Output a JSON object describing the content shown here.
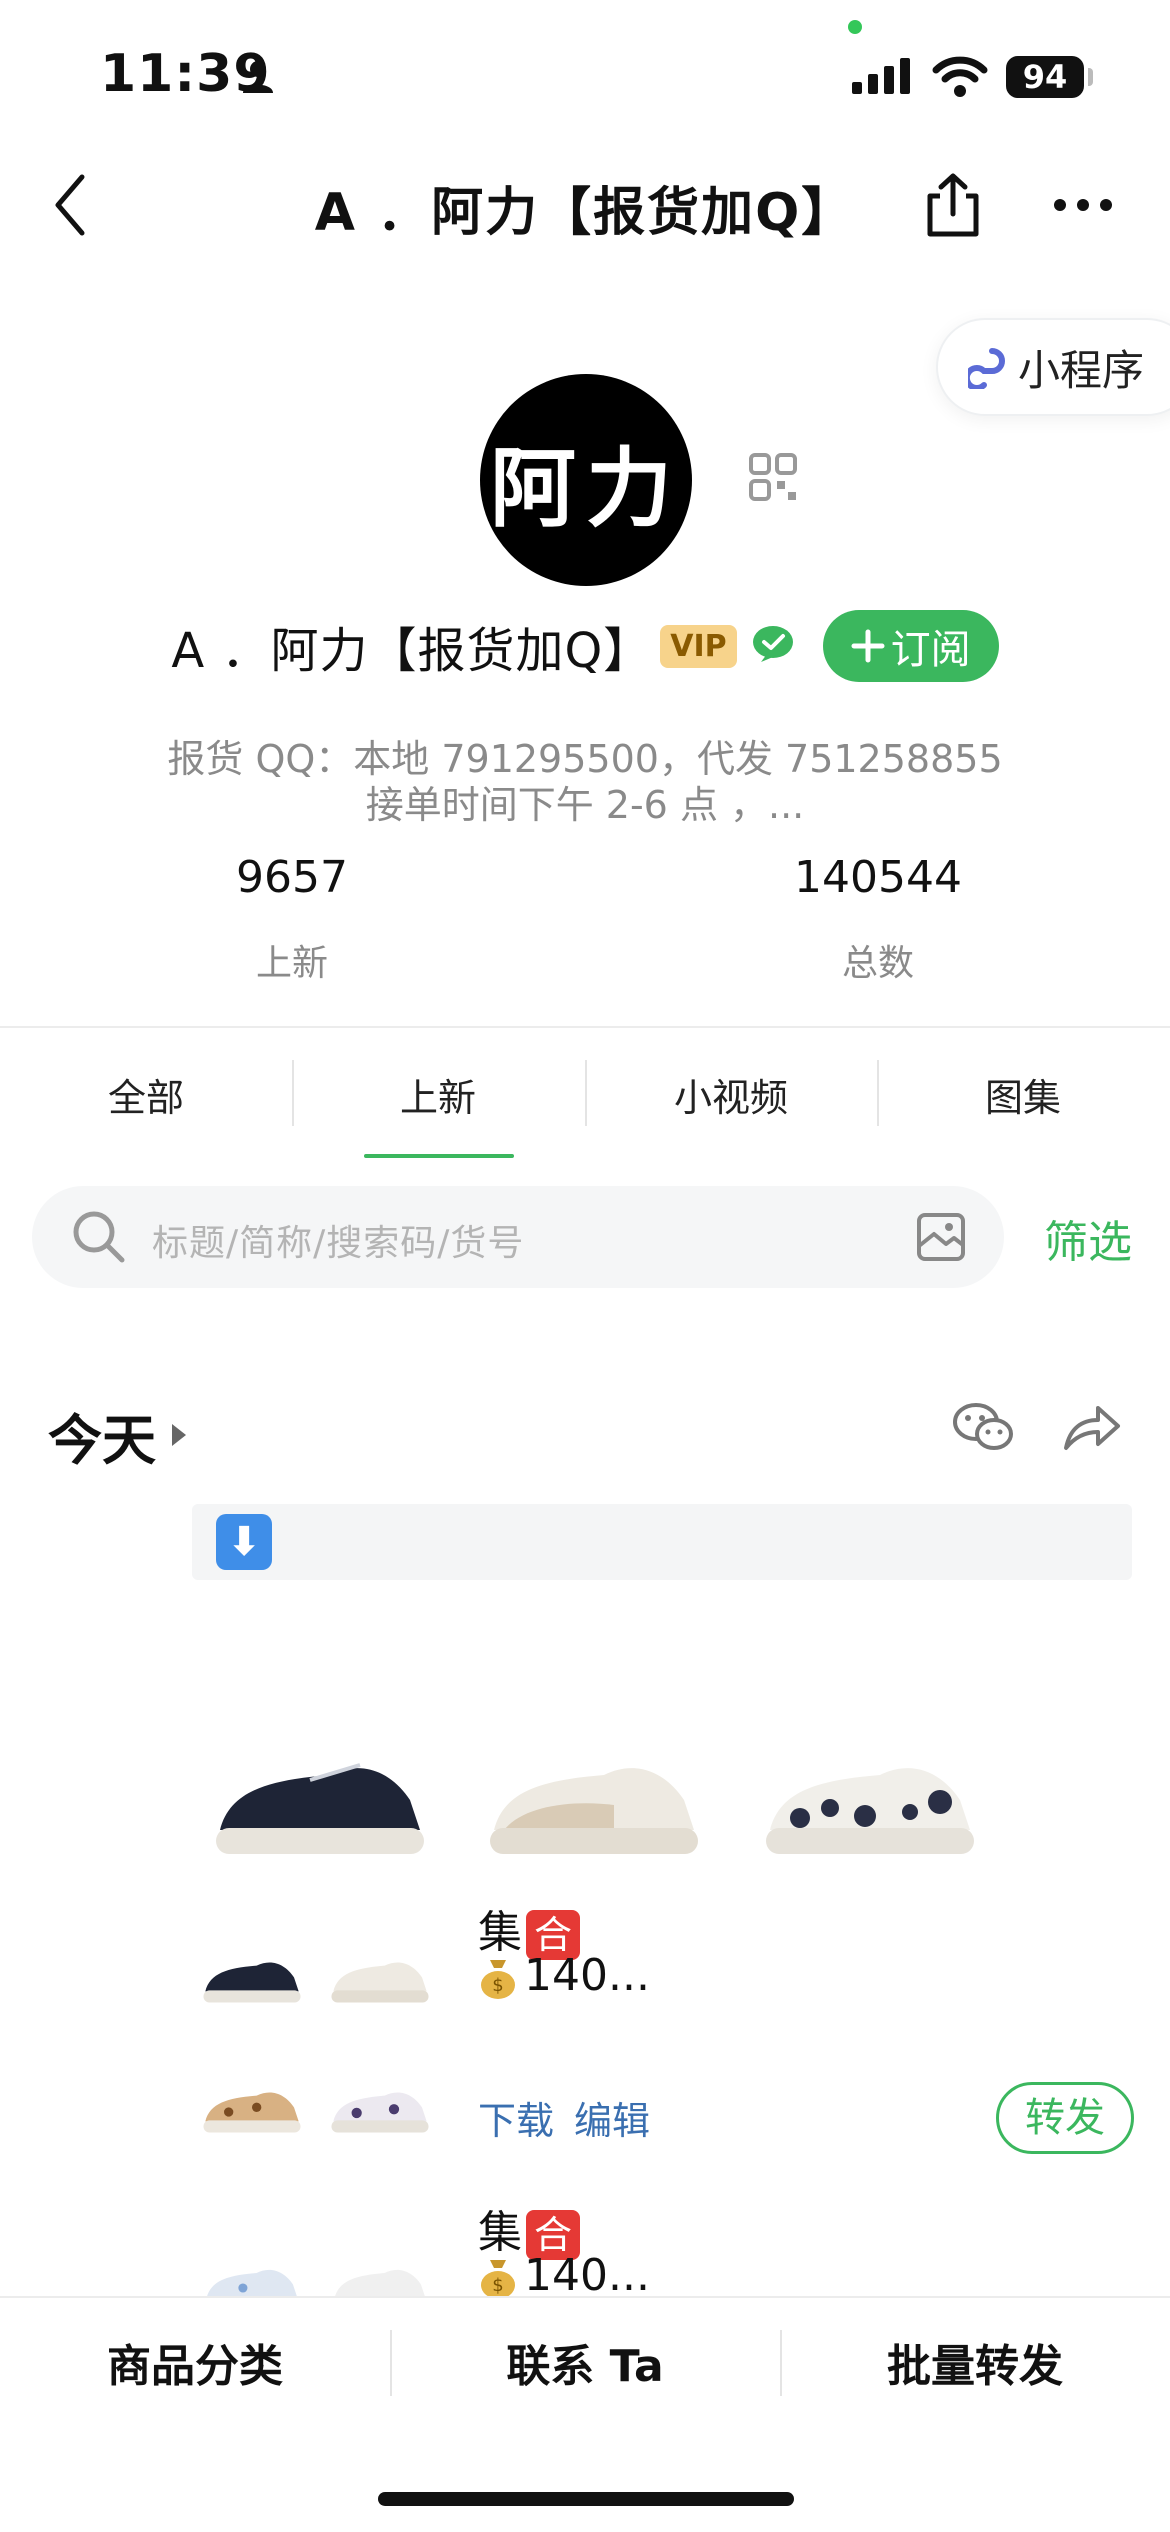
{
  "status_bar": {
    "time": "11:39",
    "battery": "94"
  },
  "header": {
    "title": "A ．阿力【报货加Q】"
  },
  "mini_program": {
    "label": "小程序"
  },
  "profile": {
    "avatar_text": "阿力",
    "name": "A ．阿力【报货加Q】",
    "vip_badge": "VIP",
    "subscribe_label": "订阅",
    "desc_line1": "报货 QQ：本地 791295500，代发 751258855",
    "desc_line2": "接单时间下午 2-6 点 ，...",
    "stats": [
      {
        "value": "9657",
        "label": "上新"
      },
      {
        "value": "140544",
        "label": "总数"
      }
    ]
  },
  "tabs": [
    {
      "label": "全部"
    },
    {
      "label": "上新",
      "active": true
    },
    {
      "label": "小视频"
    },
    {
      "label": "图集"
    }
  ],
  "search": {
    "placeholder": "标题/简称/搜索码/货号",
    "filter_label": "筛选"
  },
  "feed": {
    "section_title": "今天",
    "posts": [
      {
        "title": "集",
        "price": "140...",
        "download": "下载",
        "edit": "编辑",
        "forward": "转发"
      },
      {
        "title": "集",
        "price": "140..."
      }
    ]
  },
  "bottom_bar": [
    {
      "label": "商品分类"
    },
    {
      "label": "联系 Ta"
    },
    {
      "label": "批量转发"
    }
  ],
  "colors": {
    "accent": "#3bb75e",
    "link": "#3a6fb0",
    "vip": "#f7d38b"
  }
}
